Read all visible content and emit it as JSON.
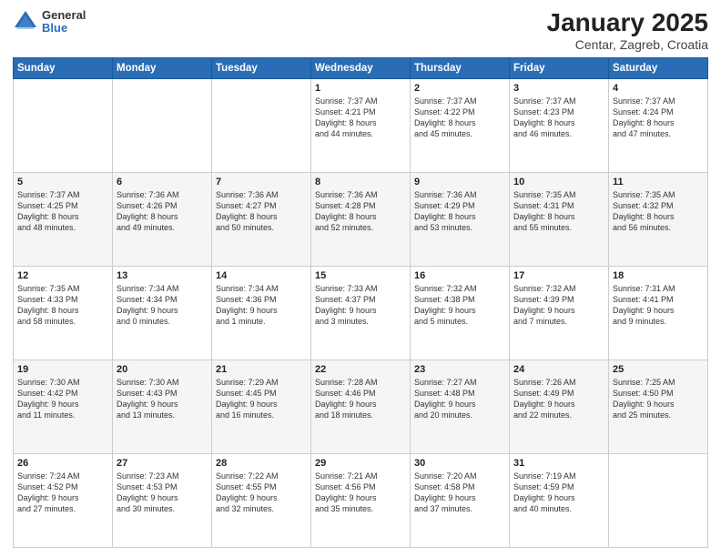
{
  "header": {
    "logo_general": "General",
    "logo_blue": "Blue",
    "title": "January 2025",
    "subtitle": "Centar, Zagreb, Croatia"
  },
  "weekdays": [
    "Sunday",
    "Monday",
    "Tuesday",
    "Wednesday",
    "Thursday",
    "Friday",
    "Saturday"
  ],
  "weeks": [
    [
      {
        "day": "",
        "info": ""
      },
      {
        "day": "",
        "info": ""
      },
      {
        "day": "",
        "info": ""
      },
      {
        "day": "1",
        "info": "Sunrise: 7:37 AM\nSunset: 4:21 PM\nDaylight: 8 hours\nand 44 minutes."
      },
      {
        "day": "2",
        "info": "Sunrise: 7:37 AM\nSunset: 4:22 PM\nDaylight: 8 hours\nand 45 minutes."
      },
      {
        "day": "3",
        "info": "Sunrise: 7:37 AM\nSunset: 4:23 PM\nDaylight: 8 hours\nand 46 minutes."
      },
      {
        "day": "4",
        "info": "Sunrise: 7:37 AM\nSunset: 4:24 PM\nDaylight: 8 hours\nand 47 minutes."
      }
    ],
    [
      {
        "day": "5",
        "info": "Sunrise: 7:37 AM\nSunset: 4:25 PM\nDaylight: 8 hours\nand 48 minutes."
      },
      {
        "day": "6",
        "info": "Sunrise: 7:36 AM\nSunset: 4:26 PM\nDaylight: 8 hours\nand 49 minutes."
      },
      {
        "day": "7",
        "info": "Sunrise: 7:36 AM\nSunset: 4:27 PM\nDaylight: 8 hours\nand 50 minutes."
      },
      {
        "day": "8",
        "info": "Sunrise: 7:36 AM\nSunset: 4:28 PM\nDaylight: 8 hours\nand 52 minutes."
      },
      {
        "day": "9",
        "info": "Sunrise: 7:36 AM\nSunset: 4:29 PM\nDaylight: 8 hours\nand 53 minutes."
      },
      {
        "day": "10",
        "info": "Sunrise: 7:35 AM\nSunset: 4:31 PM\nDaylight: 8 hours\nand 55 minutes."
      },
      {
        "day": "11",
        "info": "Sunrise: 7:35 AM\nSunset: 4:32 PM\nDaylight: 8 hours\nand 56 minutes."
      }
    ],
    [
      {
        "day": "12",
        "info": "Sunrise: 7:35 AM\nSunset: 4:33 PM\nDaylight: 8 hours\nand 58 minutes."
      },
      {
        "day": "13",
        "info": "Sunrise: 7:34 AM\nSunset: 4:34 PM\nDaylight: 9 hours\nand 0 minutes."
      },
      {
        "day": "14",
        "info": "Sunrise: 7:34 AM\nSunset: 4:36 PM\nDaylight: 9 hours\nand 1 minute."
      },
      {
        "day": "15",
        "info": "Sunrise: 7:33 AM\nSunset: 4:37 PM\nDaylight: 9 hours\nand 3 minutes."
      },
      {
        "day": "16",
        "info": "Sunrise: 7:32 AM\nSunset: 4:38 PM\nDaylight: 9 hours\nand 5 minutes."
      },
      {
        "day": "17",
        "info": "Sunrise: 7:32 AM\nSunset: 4:39 PM\nDaylight: 9 hours\nand 7 minutes."
      },
      {
        "day": "18",
        "info": "Sunrise: 7:31 AM\nSunset: 4:41 PM\nDaylight: 9 hours\nand 9 minutes."
      }
    ],
    [
      {
        "day": "19",
        "info": "Sunrise: 7:30 AM\nSunset: 4:42 PM\nDaylight: 9 hours\nand 11 minutes."
      },
      {
        "day": "20",
        "info": "Sunrise: 7:30 AM\nSunset: 4:43 PM\nDaylight: 9 hours\nand 13 minutes."
      },
      {
        "day": "21",
        "info": "Sunrise: 7:29 AM\nSunset: 4:45 PM\nDaylight: 9 hours\nand 16 minutes."
      },
      {
        "day": "22",
        "info": "Sunrise: 7:28 AM\nSunset: 4:46 PM\nDaylight: 9 hours\nand 18 minutes."
      },
      {
        "day": "23",
        "info": "Sunrise: 7:27 AM\nSunset: 4:48 PM\nDaylight: 9 hours\nand 20 minutes."
      },
      {
        "day": "24",
        "info": "Sunrise: 7:26 AM\nSunset: 4:49 PM\nDaylight: 9 hours\nand 22 minutes."
      },
      {
        "day": "25",
        "info": "Sunrise: 7:25 AM\nSunset: 4:50 PM\nDaylight: 9 hours\nand 25 minutes."
      }
    ],
    [
      {
        "day": "26",
        "info": "Sunrise: 7:24 AM\nSunset: 4:52 PM\nDaylight: 9 hours\nand 27 minutes."
      },
      {
        "day": "27",
        "info": "Sunrise: 7:23 AM\nSunset: 4:53 PM\nDaylight: 9 hours\nand 30 minutes."
      },
      {
        "day": "28",
        "info": "Sunrise: 7:22 AM\nSunset: 4:55 PM\nDaylight: 9 hours\nand 32 minutes."
      },
      {
        "day": "29",
        "info": "Sunrise: 7:21 AM\nSunset: 4:56 PM\nDaylight: 9 hours\nand 35 minutes."
      },
      {
        "day": "30",
        "info": "Sunrise: 7:20 AM\nSunset: 4:58 PM\nDaylight: 9 hours\nand 37 minutes."
      },
      {
        "day": "31",
        "info": "Sunrise: 7:19 AM\nSunset: 4:59 PM\nDaylight: 9 hours\nand 40 minutes."
      },
      {
        "day": "",
        "info": ""
      }
    ]
  ]
}
